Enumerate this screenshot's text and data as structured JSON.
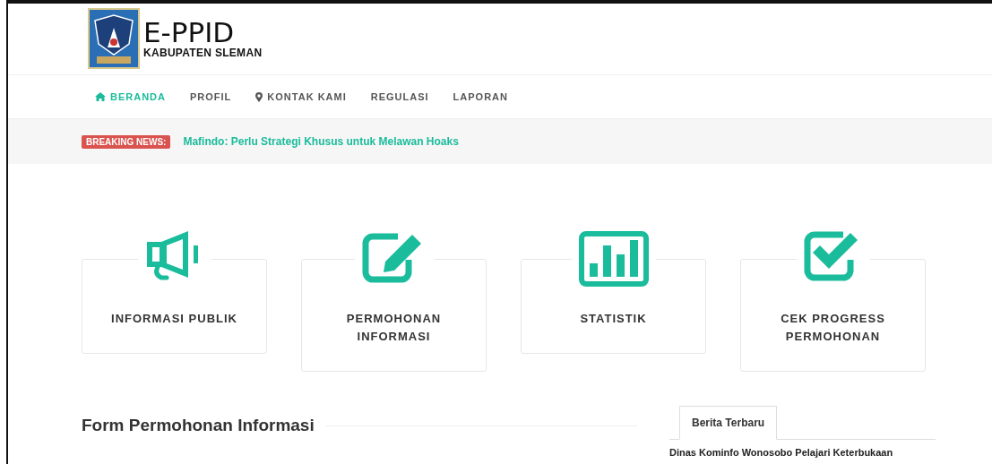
{
  "header": {
    "title": "E-PPID",
    "subtitle": "KABUPATEN SLEMAN"
  },
  "nav": [
    {
      "label": "BERANDA",
      "kind": "home",
      "selected": true
    },
    {
      "label": "PROFIL",
      "kind": "plain",
      "selected": false
    },
    {
      "label": "KONTAK KAMI",
      "kind": "location",
      "selected": false
    },
    {
      "label": "REGULASI",
      "kind": "plain",
      "selected": false
    },
    {
      "label": "LAPORAN",
      "kind": "plain",
      "selected": false
    }
  ],
  "breaking_news": {
    "badge": "BREAKING NEWS:",
    "headline": "Mafindo: Perlu Strategi Khusus untuk Melawan Hoaks"
  },
  "cards": [
    {
      "kind": "megaphone",
      "lines": [
        "INFORMASI PUBLIK"
      ]
    },
    {
      "kind": "edit",
      "lines": [
        "PERMOHONAN",
        "INFORMASI"
      ]
    },
    {
      "kind": "chart",
      "lines": [
        "STATISTIK"
      ]
    },
    {
      "kind": "check",
      "lines": [
        "CEK PROGRESS",
        "PERMOHONAN"
      ]
    }
  ],
  "form_title": "Form Permohonan Informasi",
  "sidebar": {
    "tabs": [
      {
        "label": "Berita Terbaru",
        "selected": true
      }
    ],
    "news": [
      "Dinas Kominfo Wonosobo Pelajari Keterbukaan"
    ]
  }
}
